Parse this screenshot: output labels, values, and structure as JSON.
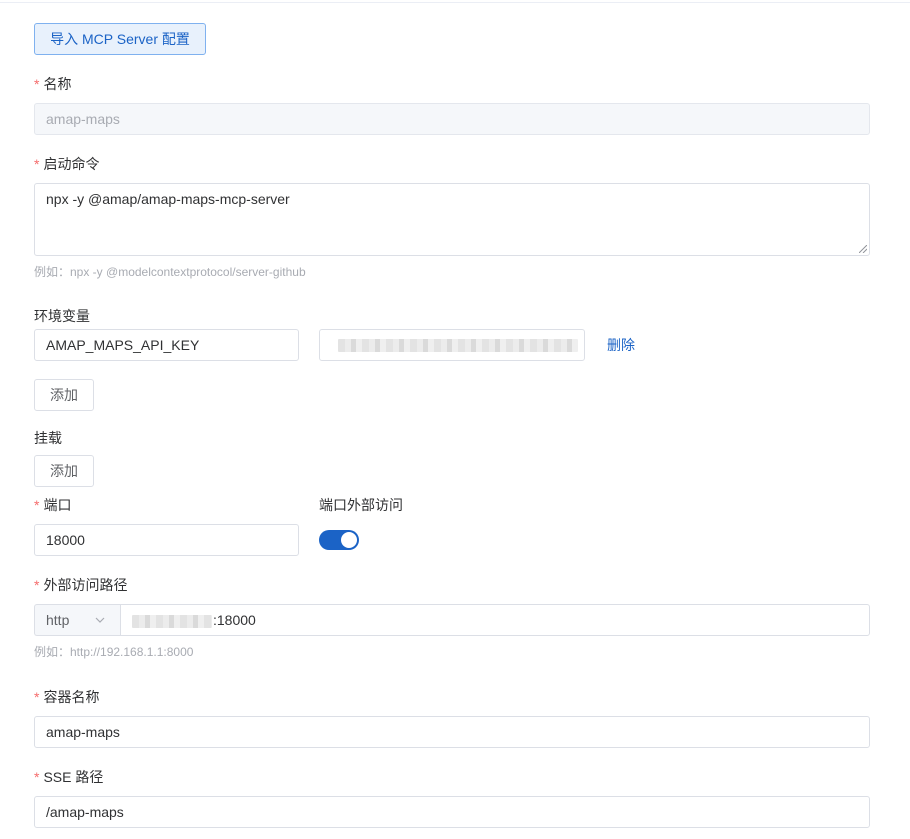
{
  "import_button": "导入 MCP Server 配置",
  "name": {
    "label": "名称",
    "value": "amap-maps"
  },
  "command": {
    "label": "启动命令",
    "value": "npx -y @amap/amap-maps-mcp-server",
    "hint": "例如：npx -y @modelcontextprotocol/server-github"
  },
  "env": {
    "label": "环境变量",
    "key": "AMAP_MAPS_API_KEY",
    "delete_label": "删除",
    "add_label": "添加"
  },
  "mount": {
    "label": "挂载",
    "add_label": "添加"
  },
  "port": {
    "label": "端口",
    "value": "18000"
  },
  "external_access": {
    "label": "端口外部访问",
    "enabled": true
  },
  "external_path": {
    "label": "外部访问路径",
    "protocol": "http",
    "port_suffix": ":18000",
    "hint": "例如：http://192.168.1.1:8000"
  },
  "container_name": {
    "label": "容器名称",
    "value": "amap-maps"
  },
  "sse_path": {
    "label": "SSE 路径",
    "value": "/amap-maps"
  },
  "colors": {
    "primary": "#1b63c6",
    "required": "#f56c6c",
    "border": "#dcdfe6"
  }
}
